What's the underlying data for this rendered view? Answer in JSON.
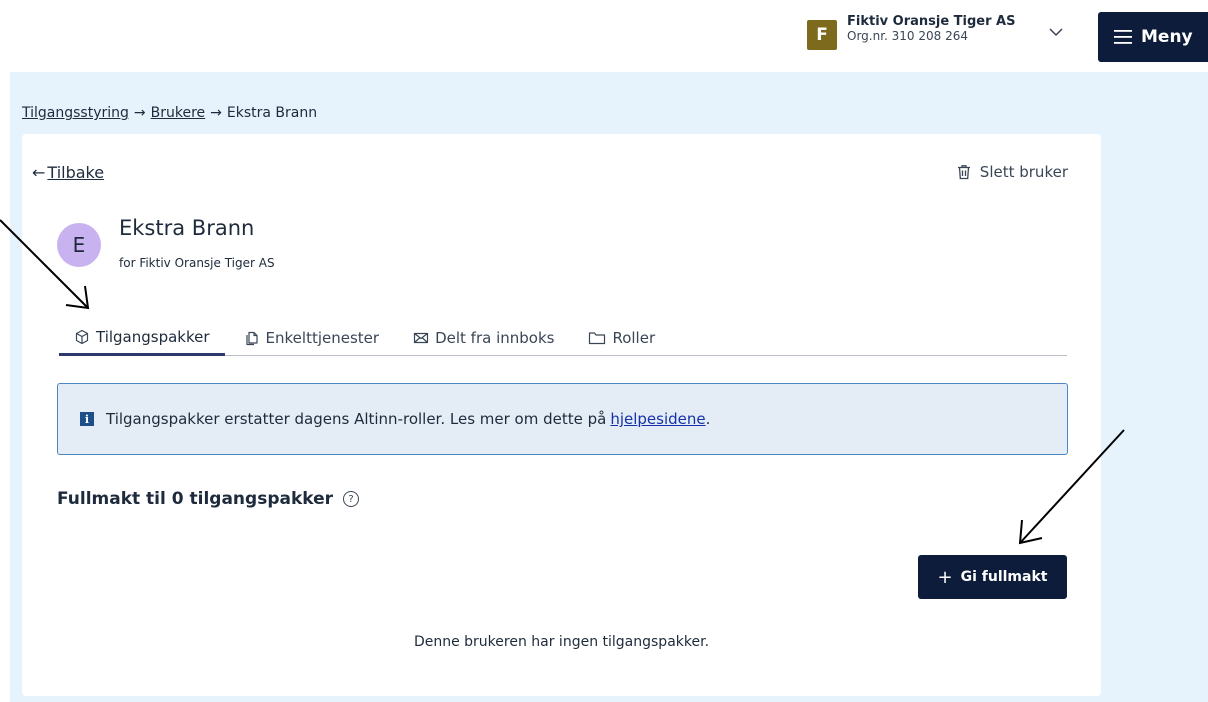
{
  "header": {
    "account": {
      "initial": "F",
      "name": "Fiktiv Oransje Tiger AS",
      "org": "Org.nr. 310 208 264",
      "avatar_color": "#7d6a1c",
      "chevron_icon": "chevron-down-icon"
    },
    "menu": {
      "label": "Meny",
      "icon": "hamburger-icon",
      "bg_color": "#0e1c3c"
    }
  },
  "breadcrumb": {
    "items": [
      {
        "label": "Tilgangsstyring",
        "link": true
      },
      {
        "label": "Brukere",
        "link": true
      },
      {
        "label": "Ekstra Brann",
        "link": false
      }
    ],
    "separator": "→"
  },
  "page": {
    "back_arrow": "←",
    "back_label": "Tilbake",
    "delete_label": "Slett bruker",
    "delete_icon": "trash-icon",
    "user": {
      "initial": "E",
      "name": "Ekstra Brann",
      "subtitle": "for Fiktiv Oransje Tiger AS",
      "avatar_color": "#c8b3f0"
    },
    "tabs": [
      {
        "label": "Tilgangspakker",
        "icon": "package-icon",
        "active": true
      },
      {
        "label": "Enkelttjenester",
        "icon": "copy-icon",
        "active": false
      },
      {
        "label": "Delt fra innboks",
        "icon": "envelope-icon",
        "active": false
      },
      {
        "label": "Roller",
        "icon": "folder-icon",
        "active": false
      }
    ],
    "alert": {
      "icon_text": "i",
      "text": "Tilgangspakker erstatter dagens Altinn-roller. Les mer om dette på",
      "link_label": "hjelpesidene",
      "suffix": "."
    },
    "section": {
      "title": "Fullmakt til 0 tilgangspakker",
      "help_icon": "?"
    },
    "give_button": {
      "plus": "+",
      "label": "Gi fullmakt"
    },
    "empty_text": "Denne brukeren har ingen tilgangspakker."
  },
  "colors": {
    "page_bg": "#e6f2fc",
    "dark_navy": "#0e1c3c",
    "alert_border": "#4c88bf",
    "alert_bg": "#e4edf6",
    "link": "#1531a8"
  }
}
